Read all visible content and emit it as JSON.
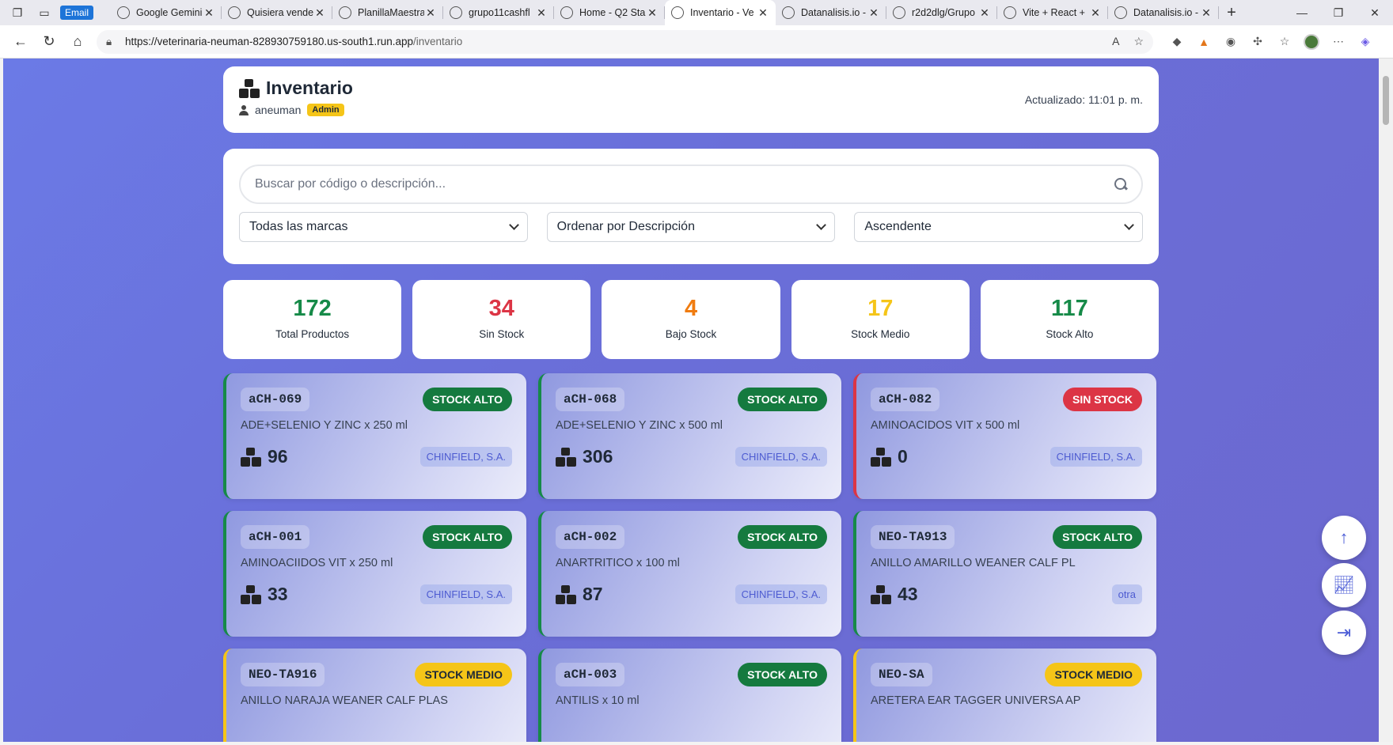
{
  "browser": {
    "tabs": [
      {
        "label": "Google Gemini",
        "active": false
      },
      {
        "label": "Quisiera vende",
        "active": false
      },
      {
        "label": "PlanillaMaestra",
        "active": false
      },
      {
        "label": "grupo11cashfl",
        "active": false
      },
      {
        "label": "Home - Q2 Sta",
        "active": false
      },
      {
        "label": "Inventario - Ve",
        "active": true
      },
      {
        "label": "Datanalisis.io -",
        "active": false
      },
      {
        "label": "r2d2dlg/Grupo",
        "active": false
      },
      {
        "label": "Vite + React +",
        "active": false
      },
      {
        "label": "Datanalisis.io -",
        "active": false
      }
    ],
    "email_chip": "Email",
    "url_host": "https://veterinaria-neuman-828930759180.us-south1.run.app",
    "url_path": "/inventario"
  },
  "header": {
    "title": "Inventario",
    "user": "aneuman",
    "role": "Admin",
    "updated": "Actualizado: 11:01 p. m."
  },
  "filters": {
    "search_placeholder": "Buscar por código o descripción...",
    "brand": "Todas las marcas",
    "sort": "Ordenar por Descripción",
    "order": "Ascendente"
  },
  "stats": [
    {
      "value": "172",
      "label": "Total Productos",
      "color": "#168a48"
    },
    {
      "value": "34",
      "label": "Sin Stock",
      "color": "#dc3545"
    },
    {
      "value": "4",
      "label": "Bajo Stock",
      "color": "#f07c10"
    },
    {
      "value": "17",
      "label": "Stock Medio",
      "color": "#f5c518"
    },
    {
      "value": "117",
      "label": "Stock Alto",
      "color": "#168a48"
    }
  ],
  "products": [
    {
      "code": "aCH-069",
      "status": "STOCK ALTO",
      "level": "green",
      "desc": "ADE+SELENIO Y ZINC x 250 ml",
      "qty": "96",
      "brand": "CHINFIELD, S.A."
    },
    {
      "code": "aCH-068",
      "status": "STOCK ALTO",
      "level": "green",
      "desc": "ADE+SELENIO Y ZINC x 500 ml",
      "qty": "306",
      "brand": "CHINFIELD, S.A."
    },
    {
      "code": "aCH-082",
      "status": "SIN STOCK",
      "level": "red",
      "desc": "AMINOACIDOS VIT x 500 ml",
      "qty": "0",
      "brand": "CHINFIELD, S.A."
    },
    {
      "code": "aCH-001",
      "status": "STOCK ALTO",
      "level": "green",
      "desc": "AMINOACIIDOS VIT x 250 ml",
      "qty": "33",
      "brand": "CHINFIELD, S.A."
    },
    {
      "code": "aCH-002",
      "status": "STOCK ALTO",
      "level": "green",
      "desc": "ANARTRITICO x 100 ml",
      "qty": "87",
      "brand": "CHINFIELD, S.A."
    },
    {
      "code": "NEO-TA913",
      "status": "STOCK ALTO",
      "level": "green",
      "desc": "ANILLO AMARILLO WEANER CALF PL",
      "qty": "43",
      "brand": "otra"
    },
    {
      "code": "NEO-TA916",
      "status": "STOCK MEDIO",
      "level": "yellow",
      "desc": "ANILLO NARAJA WEANER CALF PLAS",
      "qty": "",
      "brand": ""
    },
    {
      "code": "aCH-003",
      "status": "STOCK ALTO",
      "level": "green",
      "desc": "ANTILIS x 10 ml",
      "qty": "",
      "brand": ""
    },
    {
      "code": "NEO-SA",
      "status": "STOCK MEDIO",
      "level": "yellow",
      "desc": "ARETERA EAR TAGGER UNIVERSA AP",
      "qty": "",
      "brand": ""
    }
  ]
}
